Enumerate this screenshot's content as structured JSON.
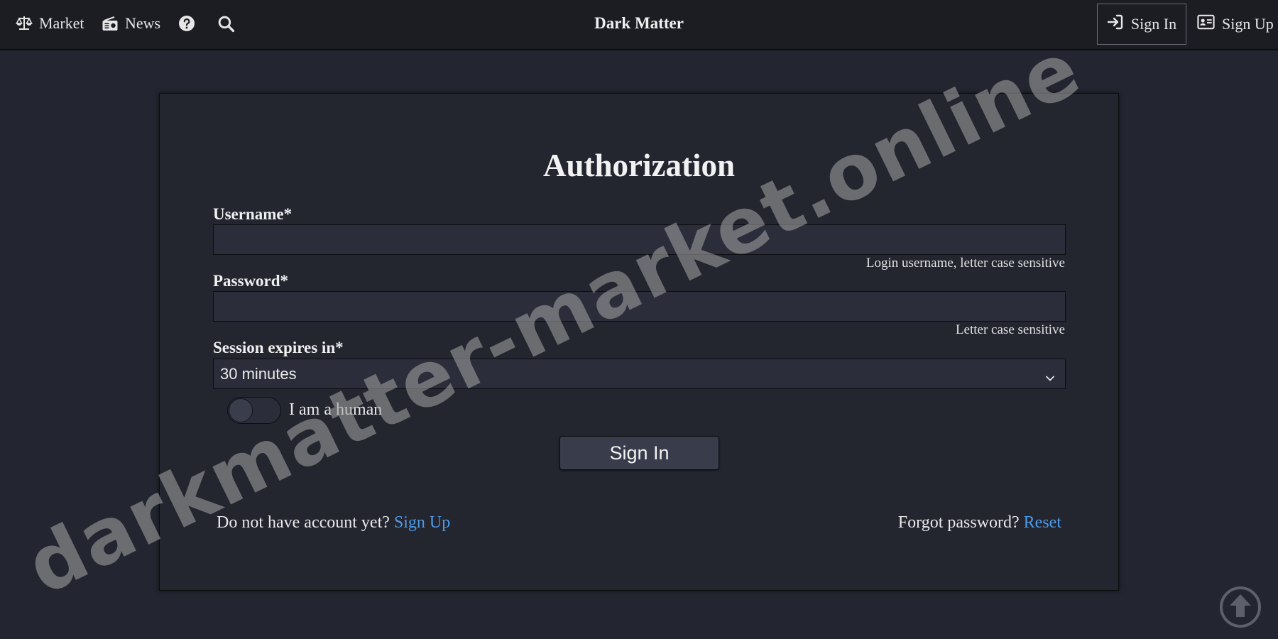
{
  "topbar": {
    "market_label": "Market",
    "news_label": "News",
    "brand": "Dark Matter",
    "signin_label": "Sign In",
    "signup_label": "Sign Up"
  },
  "form": {
    "title": "Authorization",
    "username_label": "Username*",
    "username_value": "",
    "username_hint": "Login username, letter case sensitive",
    "password_label": "Password*",
    "password_value": "",
    "password_hint": "Letter case sensitive",
    "session_label": "Session expires in*",
    "session_selected": "30 minutes",
    "human_label": "I am a human",
    "human_checked": false,
    "submit_label": "Sign In",
    "no_account_text": "Do not have account yet?",
    "signup_link": "Sign Up",
    "forgot_text": "Forgot password?",
    "reset_link": "Reset"
  },
  "watermark": "darkmatter-market.online",
  "colors": {
    "background": "#232630",
    "topbar": "#1b1d23",
    "card": "#23252f",
    "input": "#2b2e3a",
    "link": "#4d9be8",
    "button": "#393c4a"
  },
  "icons": {
    "market": "balance-scale-icon",
    "news": "radio-icon",
    "help": "question-circle-icon",
    "search": "search-icon",
    "signin": "sign-in-icon",
    "signup": "id-card-icon",
    "select_arrow": "chevron-down-icon",
    "scroll_top": "arrow-up-circle-icon"
  }
}
